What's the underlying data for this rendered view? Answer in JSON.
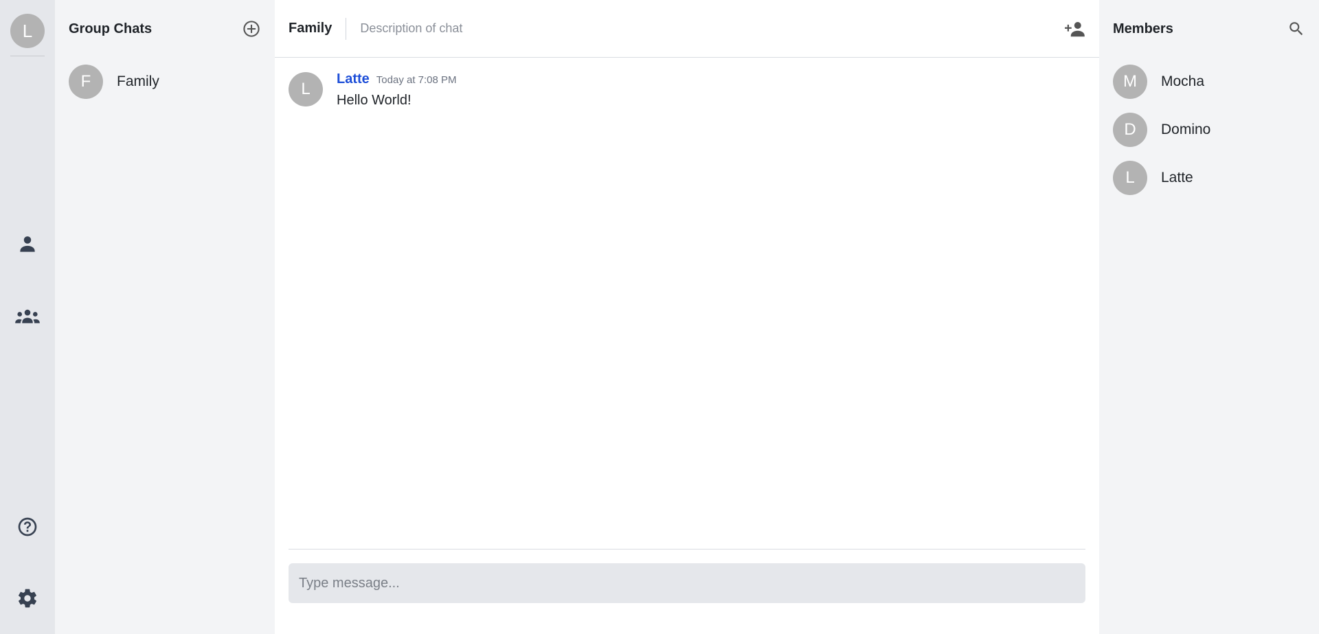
{
  "rail": {
    "me_initial": "L"
  },
  "groups": {
    "title": "Group Chats",
    "items": [
      {
        "initial": "F",
        "name": "Family"
      }
    ]
  },
  "chat": {
    "title": "Family",
    "description": "Description of chat",
    "messages": [
      {
        "initial": "L",
        "author": "Latte",
        "time": "Today at 7:08 PM",
        "text": "Hello World!"
      }
    ],
    "composer": {
      "placeholder": "Type message..."
    }
  },
  "members": {
    "title": "Members",
    "items": [
      {
        "initial": "M",
        "name": "Mocha"
      },
      {
        "initial": "D",
        "name": "Domino"
      },
      {
        "initial": "L",
        "name": "Latte"
      }
    ]
  },
  "colors": {
    "author": "#1d4ed8",
    "avatar": "#b3b3b3",
    "rail": "#e5e7eb",
    "panel": "#f3f4f6"
  },
  "icons": {
    "rail": [
      "person-icon",
      "group-icon",
      "help-icon",
      "gear-icon"
    ],
    "groups_header": "add-circle-icon",
    "chat_header": "person-add-icon",
    "members_header": "search-icon"
  }
}
